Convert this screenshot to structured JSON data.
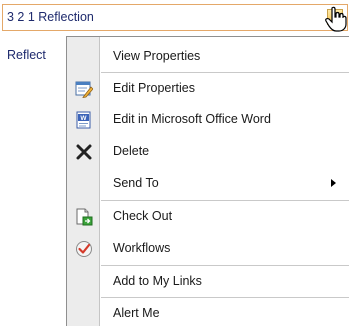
{
  "item": {
    "title": "3 2 1 Reflection",
    "title_under": "Reflect"
  },
  "menu": {
    "view_properties": "View Properties",
    "edit_properties": "Edit Properties",
    "edit_in_word": "Edit in Microsoft Office Word",
    "delete": "Delete",
    "send_to": "Send To",
    "check_out": "Check Out",
    "workflows": "Workflows",
    "add_to_my_links": "Add to My Links",
    "alert_me": "Alert Me"
  },
  "colors": {
    "selected_border": "#e4a869",
    "link_text": "#1e2a6d",
    "gutter": "#ececec"
  },
  "icons": {
    "edit_properties": "edit-properties-icon",
    "edit_in_word": "word-document-icon",
    "delete": "delete-x-icon",
    "check_out": "check-out-icon",
    "workflows": "workflows-icon",
    "pointer": "hand-pointer-icon"
  }
}
